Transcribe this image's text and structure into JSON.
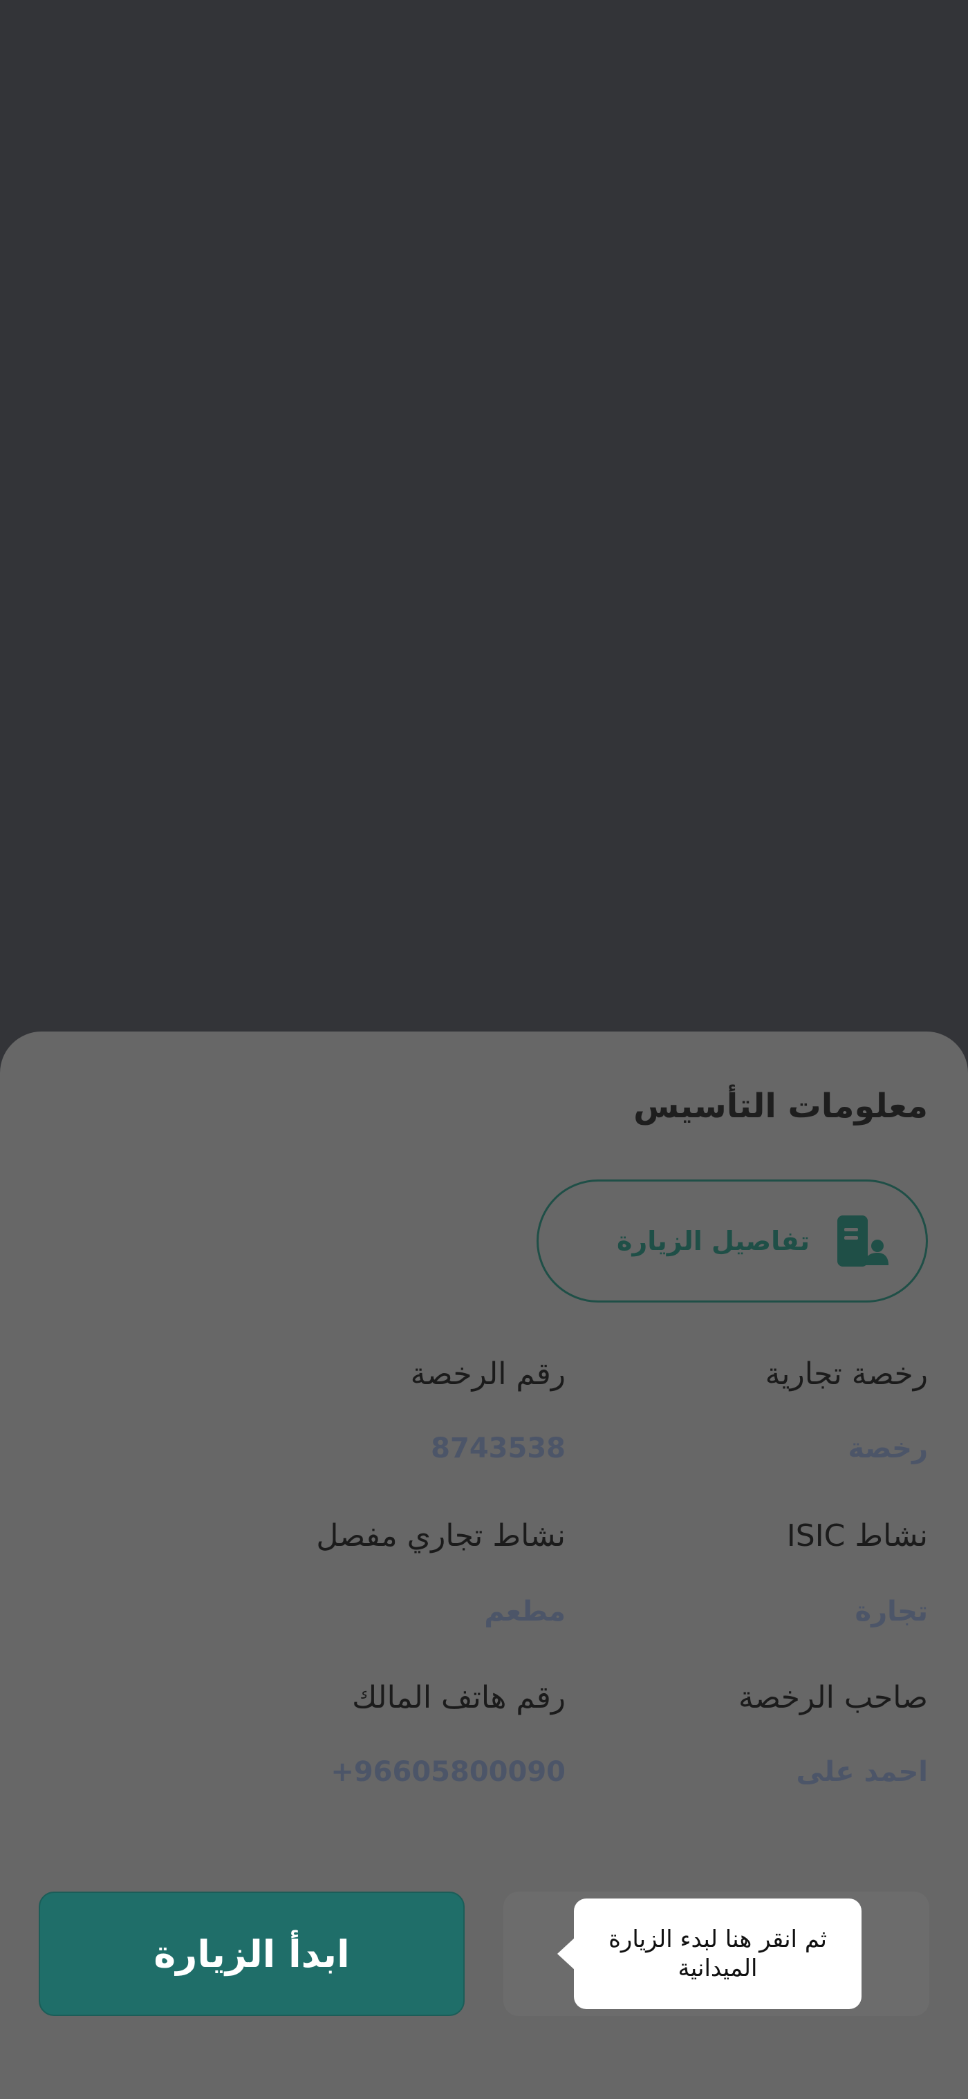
{
  "sheet": {
    "title": "معلومات التأسيس",
    "details_button": {
      "label": "تفاصيل الزيارة",
      "icon": "document-person-icon"
    },
    "fields": [
      {
        "label": "رخصة تجارية",
        "value": "رخصة"
      },
      {
        "label": "رقم الرخصة",
        "value": "8743538"
      },
      {
        "label": "نشاط ISIC",
        "value": "تجارة"
      },
      {
        "label": "نشاط تجاري مفصل",
        "value": "مطعم"
      },
      {
        "label": "صاحب الرخصة",
        "value": "احمد على"
      },
      {
        "label": "رقم هاتف المالك",
        "value": "+96605800090"
      }
    ]
  },
  "actions": {
    "start_label": "ابدأ الزيارة"
  },
  "tooltip": {
    "text": "ثم انقر هنا لبدء الزيارة الميدانية"
  },
  "colors": {
    "backdrop": "#333438",
    "sheet": "#676767",
    "primary": "#1f6e69",
    "value_text": "#4c5568"
  }
}
